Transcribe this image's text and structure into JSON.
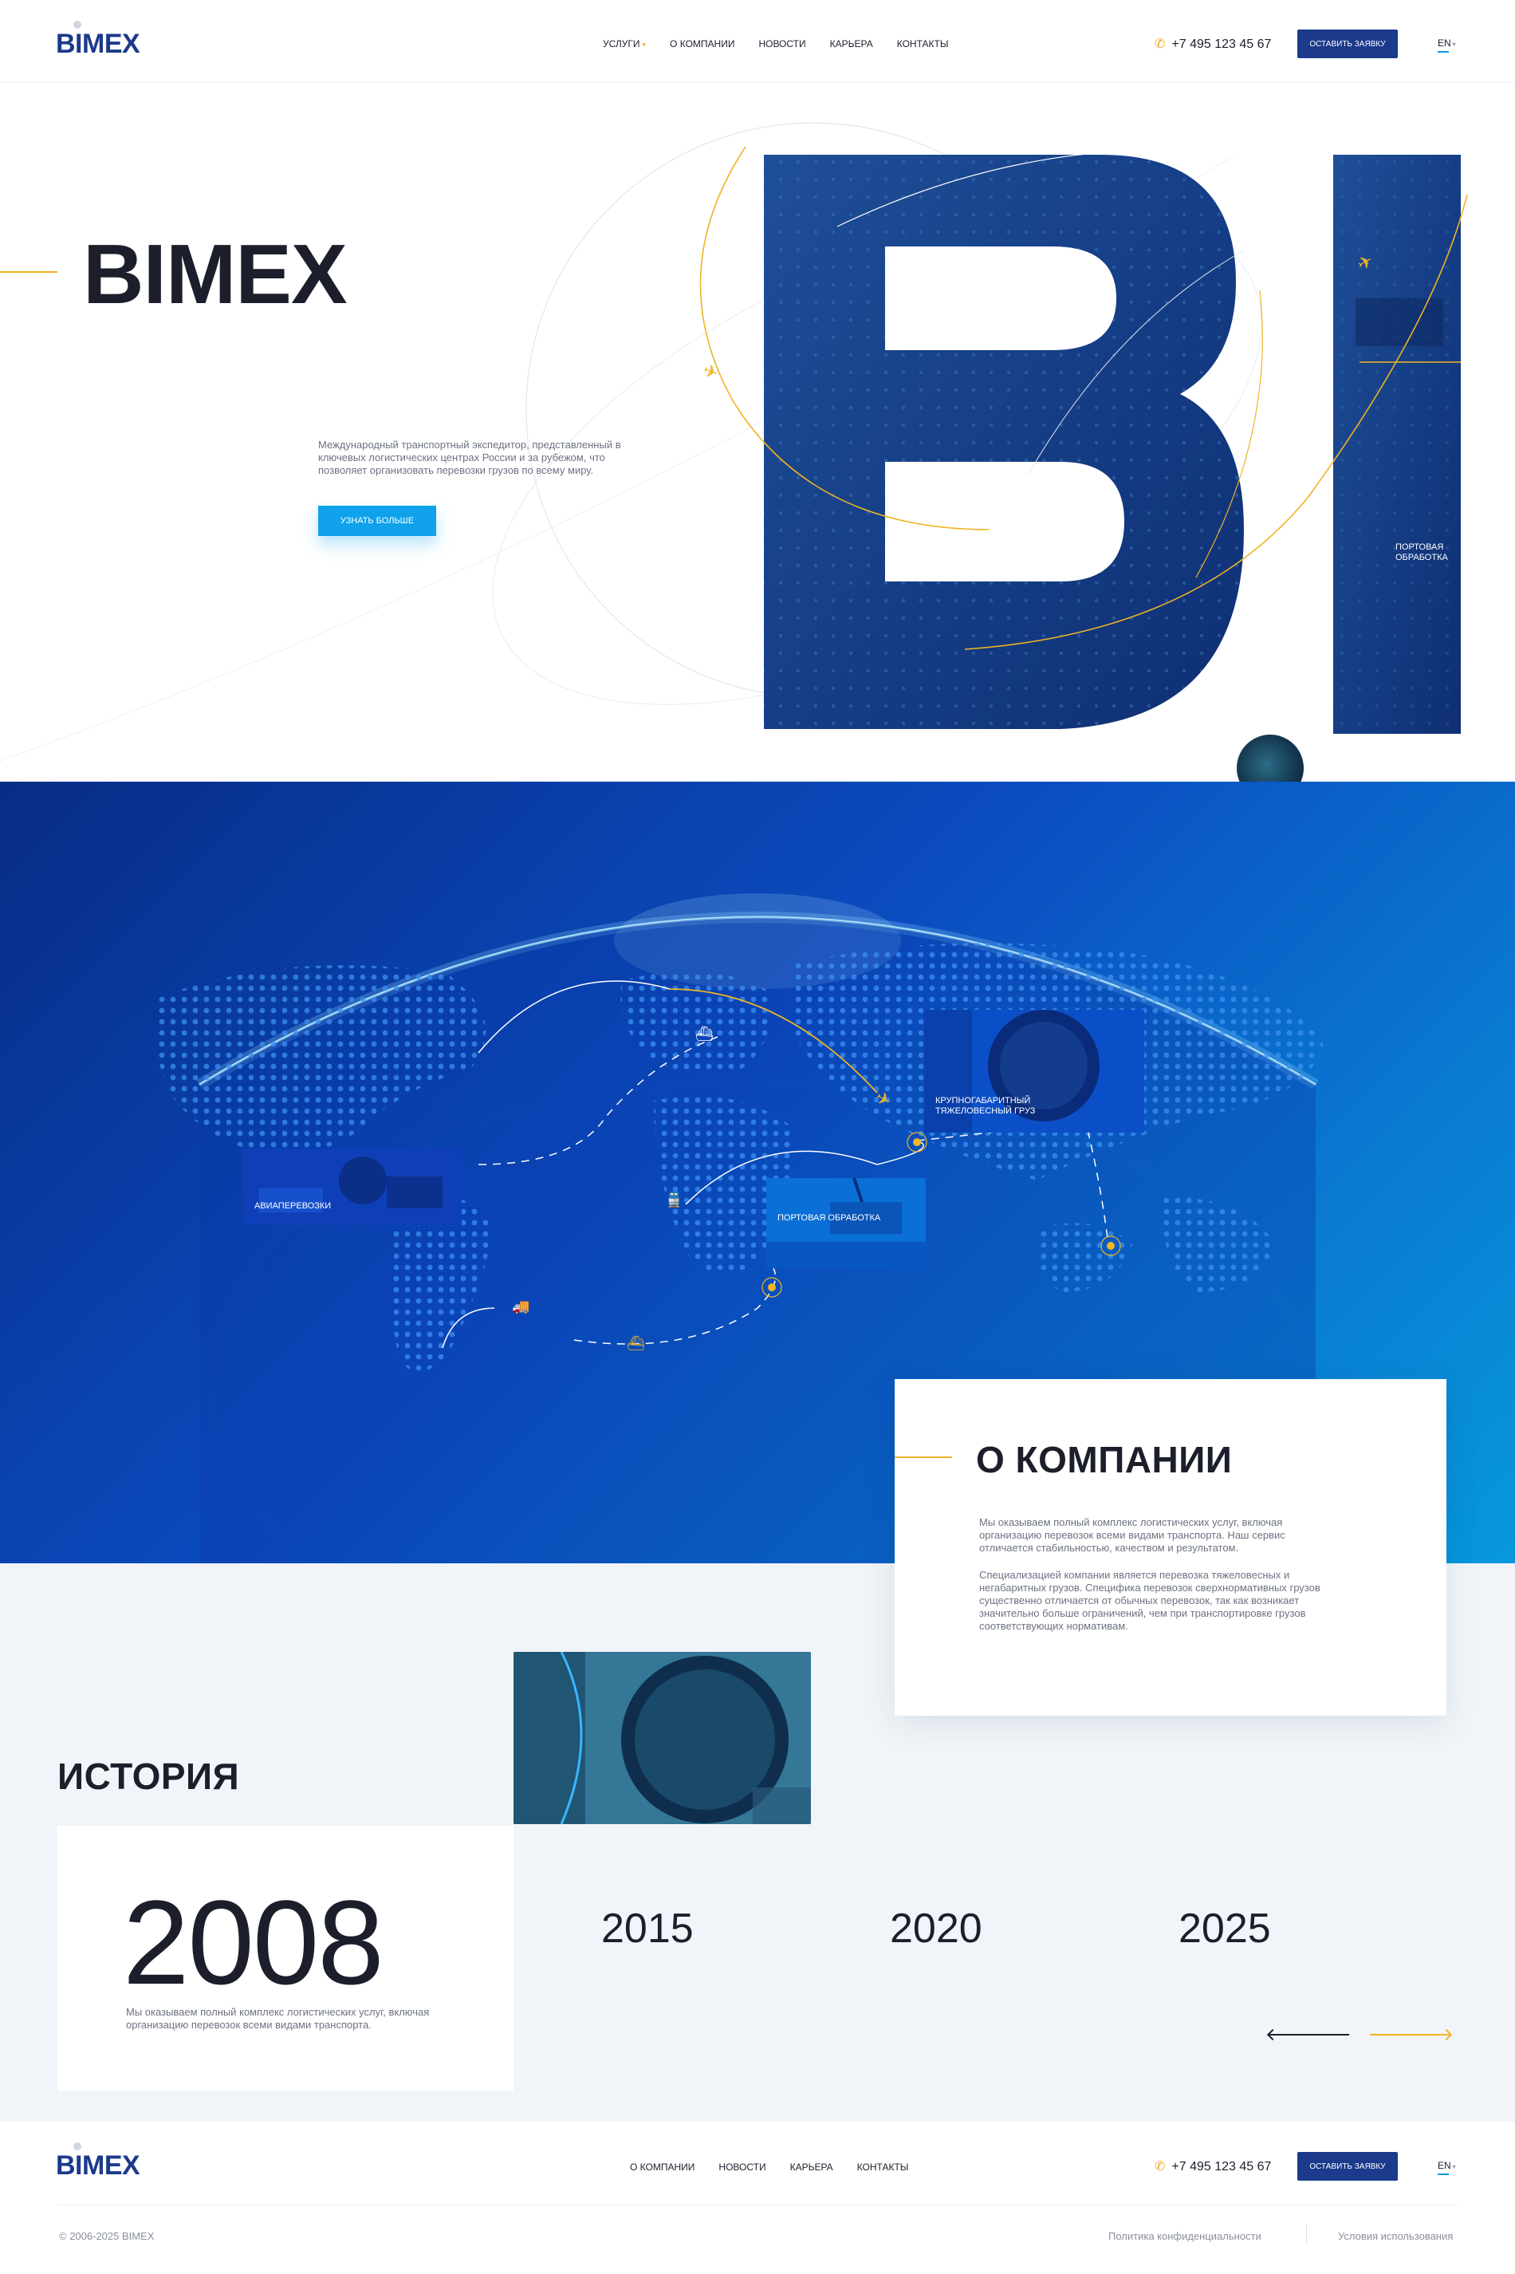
{
  "header": {
    "logo": "BIMEX",
    "nav": [
      {
        "label": "Услуги",
        "has_dropdown": true
      },
      {
        "label": "О компании"
      },
      {
        "label": "Новости"
      },
      {
        "label": "Карьера"
      },
      {
        "label": "Контакты"
      }
    ],
    "phone": "+7 495 123 45 67",
    "cta": "Оставить заявку",
    "lang": "EN"
  },
  "hero": {
    "title": "BIMEX",
    "text": "Международный транспортный экспедитор, представленный в ключевых логистических центрах России и за рубежом, что позволяет организовать перевозки грузов по всему миру.",
    "button": "Узнать больше",
    "big_letters": "B.I",
    "slide_caption": "Портовая обработка",
    "dots_count": 6,
    "active_dot": 0
  },
  "map": {
    "cards": [
      {
        "caption": "Авиаперевозки"
      },
      {
        "caption": "Портовая обработка"
      },
      {
        "caption": "Крупногабаритный тяжеловесный груз"
      }
    ]
  },
  "about": {
    "title": "О компании",
    "p1": "Мы оказываем полный комплекс логистических услуг, включая организацию перевозок всеми видами транспорта. Наш сервис отличается стабильностью, качеством и результатом.",
    "p2": "Специализацией компании является перевозка тяжеловесных и негабаритных грузов. Специфика перевозок сверхнормативных грузов существенно отличается от обычных перевозок, так как возникает значительно больше ограничений, чем при транспортировке грузов соответствующих нормативам."
  },
  "history": {
    "title": "История",
    "active_year": "2008",
    "active_text": "Мы оказываем полный комплекс логистических услуг, включая организацию перевозок всеми видами транспорта.",
    "years": [
      "2015",
      "2020",
      "2025"
    ]
  },
  "footer": {
    "logo": "BIMEX",
    "nav": [
      "О компании",
      "Новости",
      "Карьера",
      "Контакты"
    ],
    "phone": "+7 495 123 45 67",
    "cta": "Оставить заявку",
    "lang": "EN",
    "copyright": "© 2006-2025 BIMEX",
    "privacy": "Политика конфиденциальности",
    "terms": "Условия использования"
  },
  "colors": {
    "brand": "#1b3a8c",
    "accent": "#f0b424",
    "cta_light": "#0fa2ea"
  }
}
